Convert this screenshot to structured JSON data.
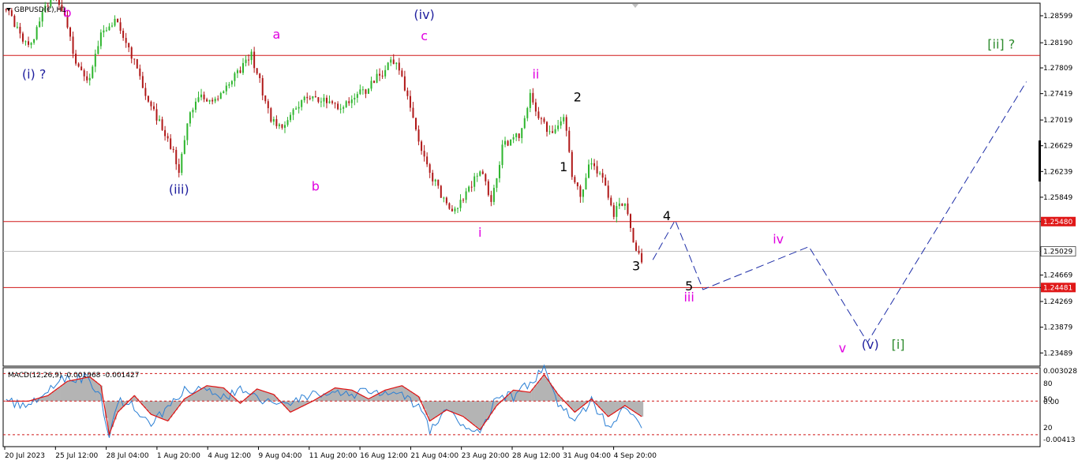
{
  "chart_data": {
    "type": "candlestick",
    "symbol_label": "GBPUSD(€),H1",
    "ylim": [
      1.23289,
      1.2879
    ],
    "y_ticks": [
      "1.28599",
      "1.28190",
      "1.27809",
      "1.27419",
      "1.27019",
      "1.26629",
      "1.26239",
      "1.25849",
      "1.25480",
      "1.25029",
      "1.24669",
      "1.24481",
      "1.24269",
      "1.23879",
      "1.23489"
    ],
    "x_ticks": [
      "20 Jul 2023",
      "25 Jul 12:00",
      "28 Jul 04:00",
      "1 Aug 20:00",
      "4 Aug 12:00",
      "9 Aug 04:00",
      "11 Aug 20:00",
      "16 Aug 12:00",
      "21 Aug 04:00",
      "23 Aug 20:00",
      "28 Aug 12:00",
      "31 Aug 04:00",
      "4 Sep 20:00"
    ],
    "price_path": [
      [
        0,
        1.287
      ],
      [
        4,
        1.284
      ],
      [
        8,
        1.281
      ],
      [
        12,
        1.285
      ],
      [
        16,
        1.289
      ],
      [
        20,
        1.287
      ],
      [
        25,
        1.279
      ],
      [
        30,
        1.276
      ],
      [
        34,
        1.284
      ],
      [
        40,
        1.285
      ],
      [
        46,
        1.279
      ],
      [
        50,
        1.274
      ],
      [
        56,
        1.269
      ],
      [
        60,
        1.265
      ],
      [
        62,
        1.262
      ],
      [
        65,
        1.27
      ],
      [
        70,
        1.274
      ],
      [
        76,
        1.273
      ],
      [
        80,
        1.276
      ],
      [
        84,
        1.278
      ],
      [
        88,
        1.28
      ],
      [
        91,
        1.276
      ],
      [
        95,
        1.27
      ],
      [
        98,
        1.269
      ],
      [
        102,
        1.271
      ],
      [
        108,
        1.274
      ],
      [
        114,
        1.273
      ],
      [
        120,
        1.272
      ],
      [
        126,
        1.274
      ],
      [
        130,
        1.275
      ],
      [
        134,
        1.277
      ],
      [
        138,
        1.279
      ],
      [
        141,
        1.278
      ],
      [
        145,
        1.272
      ],
      [
        150,
        1.264
      ],
      [
        156,
        1.259
      ],
      [
        160,
        1.256
      ],
      [
        166,
        1.26
      ],
      [
        170,
        1.263
      ],
      [
        174,
        1.258
      ],
      [
        178,
        1.266
      ],
      [
        184,
        1.268
      ],
      [
        188,
        1.274
      ],
      [
        192,
        1.27
      ],
      [
        196,
        1.268
      ],
      [
        200,
        1.271
      ],
      [
        203,
        1.262
      ],
      [
        206,
        1.259
      ],
      [
        210,
        1.264
      ],
      [
        214,
        1.261
      ],
      [
        218,
        1.256
      ],
      [
        222,
        1.258
      ],
      [
        225,
        1.252
      ],
      [
        228,
        1.249
      ]
    ],
    "y_lines": [
      1.27998,
      1.2548,
      1.24481
    ],
    "current_price": 1.25029,
    "projection": [
      [
        232,
        1.249
      ],
      [
        240,
        1.255
      ],
      [
        250,
        1.2445
      ],
      [
        288,
        1.251
      ],
      [
        309,
        1.2365
      ],
      [
        366,
        1.276
      ]
    ],
    "wave_labels": [
      {
        "text": "b",
        "x": 22,
        "y": 1.2858,
        "color": "#e000e0"
      },
      {
        "text": "(i) ?",
        "x": 10,
        "y": 1.2765,
        "color": "#1e1e9e"
      },
      {
        "text": "(iii)",
        "x": 62,
        "y": 1.259,
        "color": "#1e1e9e"
      },
      {
        "text": "a",
        "x": 97,
        "y": 1.2825,
        "color": "#e000e0"
      },
      {
        "text": "b",
        "x": 111,
        "y": 1.2595,
        "color": "#e000e0"
      },
      {
        "text": "(iv)",
        "x": 150,
        "y": 1.2855,
        "color": "#1e1e9e"
      },
      {
        "text": "c",
        "x": 150,
        "y": 1.2823,
        "color": "#e000e0"
      },
      {
        "text": "i",
        "x": 170,
        "y": 1.2525,
        "color": "#e000e0"
      },
      {
        "text": "ii",
        "x": 190,
        "y": 1.2765,
        "color": "#e000e0"
      },
      {
        "text": "2",
        "x": 205,
        "y": 1.273,
        "color": "#000000"
      },
      {
        "text": "1",
        "x": 200,
        "y": 1.2624,
        "color": "#000000"
      },
      {
        "text": "3",
        "x": 226,
        "y": 1.2474,
        "color": "#000000"
      },
      {
        "text": "4",
        "x": 237,
        "y": 1.255,
        "color": "#000000"
      },
      {
        "text": "5",
        "x": 245,
        "y": 1.2444,
        "color": "#000000"
      },
      {
        "text": "iii",
        "x": 245,
        "y": 1.2427,
        "color": "#e000e0"
      },
      {
        "text": "iv",
        "x": 277,
        "y": 1.2515,
        "color": "#e000e0"
      },
      {
        "text": "v",
        "x": 300,
        "y": 1.235,
        "color": "#e000e0"
      },
      {
        "text": "(v)",
        "x": 310,
        "y": 1.2355,
        "color": "#1e1e9e"
      },
      {
        "text": "[i]",
        "x": 320,
        "y": 1.2355,
        "color": "#2e8b2e"
      },
      {
        "text": "[ii] ?",
        "x": 357,
        "y": 1.281,
        "color": "#2e8b2e"
      }
    ],
    "macd": {
      "label": "MACD(12,26,9) -0.001968 -0.001427",
      "right_ticks": [
        "0.003028",
        "80",
        "50",
        "0.00",
        "20",
        "-0.00413"
      ],
      "ylim": [
        -0.00413,
        0.003028
      ],
      "levels": [
        0.0025,
        0.0,
        -0.00305
      ],
      "signal_path": [
        [
          0,
          0.0
        ],
        [
          8,
          0.0
        ],
        [
          15,
          0.0005
        ],
        [
          22,
          0.0018
        ],
        [
          30,
          0.0022
        ],
        [
          34,
          0.0014
        ],
        [
          37,
          -0.003
        ],
        [
          40,
          -0.001
        ],
        [
          46,
          0.0005
        ],
        [
          52,
          -0.0012
        ],
        [
          58,
          -0.0018
        ],
        [
          64,
          0.0002
        ],
        [
          72,
          0.0014
        ],
        [
          78,
          0.0012
        ],
        [
          84,
          -0.0002
        ],
        [
          90,
          0.0011
        ],
        [
          96,
          0.0006
        ],
        [
          102,
          -0.001
        ],
        [
          110,
          0.0
        ],
        [
          118,
          0.0012
        ],
        [
          124,
          0.001
        ],
        [
          130,
          0.0002
        ],
        [
          136,
          0.001
        ],
        [
          142,
          0.0014
        ],
        [
          148,
          0.0004
        ],
        [
          152,
          -0.0018
        ],
        [
          158,
          -0.0008
        ],
        [
          164,
          -0.0014
        ],
        [
          170,
          -0.0026
        ],
        [
          176,
          -0.0004
        ],
        [
          182,
          0.001
        ],
        [
          188,
          0.0008
        ],
        [
          193,
          0.0024
        ],
        [
          198,
          0.0006
        ],
        [
          204,
          -0.001
        ],
        [
          210,
          0.0002
        ],
        [
          216,
          -0.0014
        ],
        [
          222,
          -0.0004
        ],
        [
          228,
          -0.0014
        ]
      ],
      "macd_path": [
        [
          0,
          0.0
        ],
        [
          8,
          -0.0006
        ],
        [
          15,
          0.0012
        ],
        [
          22,
          0.0022
        ],
        [
          30,
          0.002
        ],
        [
          34,
          0.0004
        ],
        [
          37,
          -0.0034
        ],
        [
          40,
          0.0
        ],
        [
          46,
          -0.0005
        ],
        [
          52,
          -0.002
        ],
        [
          58,
          -0.0006
        ],
        [
          64,
          0.0012
        ],
        [
          72,
          0.0008
        ],
        [
          78,
          0.0004
        ],
        [
          84,
          0.001
        ],
        [
          90,
          0.0004
        ],
        [
          96,
          -0.0004
        ],
        [
          102,
          -0.0004
        ],
        [
          110,
          0.0008
        ],
        [
          118,
          0.0006
        ],
        [
          124,
          0.0004
        ],
        [
          130,
          0.001
        ],
        [
          136,
          0.0006
        ],
        [
          142,
          0.0006
        ],
        [
          148,
          -0.0006
        ],
        [
          152,
          -0.0026
        ],
        [
          158,
          -0.001
        ],
        [
          164,
          -0.002
        ],
        [
          170,
          -0.003
        ],
        [
          176,
          0.0004
        ],
        [
          182,
          0.0004
        ],
        [
          188,
          0.0016
        ],
        [
          193,
          0.003
        ],
        [
          198,
          -0.0004
        ],
        [
          204,
          -0.0018
        ],
        [
          210,
          0.0
        ],
        [
          216,
          -0.0022
        ],
        [
          222,
          -0.0008
        ],
        [
          228,
          -0.002
        ]
      ]
    }
  },
  "colors": {
    "bull": "#2db52d",
    "bear": "#b01818",
    "hline": "#d01818",
    "current_line": "#c0c0c0",
    "projection": "#1e2ea8",
    "macd_hist": "#b4b4b4",
    "macd_signal": "#e01010",
    "macd_main": "#2a7fd4",
    "macd_level": "#d01818",
    "price_tag_bg": "#e01818",
    "current_tag_bg": "#ffffff"
  },
  "icons": {
    "menu_triangle": "triangle-down-icon",
    "scroll_marker": "triangle-down-icon"
  }
}
